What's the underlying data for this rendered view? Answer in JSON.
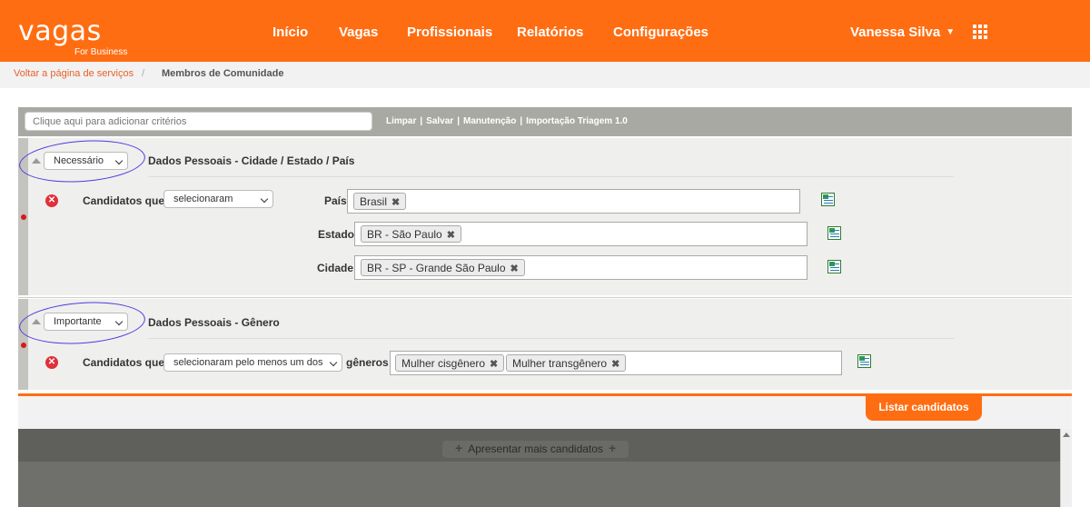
{
  "brand": {
    "name": "vagas",
    "sub": "For Business",
    "accent": "#ff6d12"
  },
  "nav": {
    "items": [
      {
        "label": "Início"
      },
      {
        "label": "Vagas"
      },
      {
        "label": "Profissionais"
      },
      {
        "label": "Relatórios"
      },
      {
        "label": "Configurações"
      }
    ],
    "user": "Vanessa Silva",
    "apps_icon": "apps-grid-icon"
  },
  "breadcrumb": {
    "back": "Voltar a página de serviços",
    "separator": "/",
    "current": "Membros de Comunidade"
  },
  "criteria": {
    "placeholder": "Clique aqui para adicionar critérios",
    "actions": [
      "Limpar",
      "Salvar",
      "Manutenção",
      "Importação Triagem 1.0"
    ],
    "separator": "|"
  },
  "sections": [
    {
      "priority": "Necessário",
      "title": "Dados Pessoais - Cidade / Estado / País",
      "condition_prefix": "Candidatos que",
      "condition": "selecionaram",
      "fields": [
        {
          "label": "País",
          "tags": [
            "Brasil"
          ]
        },
        {
          "label": "Estado",
          "tags": [
            "BR - São Paulo"
          ]
        },
        {
          "label": "Cidade",
          "tags": [
            "BR - SP - Grande São Paulo"
          ]
        }
      ]
    },
    {
      "priority": "Importante",
      "title": "Dados Pessoais - Gênero",
      "condition_prefix": "Candidatos que",
      "condition": "selecionaram pelo menos um dos",
      "suffix": "gêneros",
      "tags": [
        "Mulher cisgênero",
        "Mulher transgênero"
      ]
    }
  ],
  "list_button": "Listar candidatos",
  "more_button": "Apresentar mais candidatos",
  "remove_glyph": "✕",
  "tag_remove_glyph": "✖"
}
